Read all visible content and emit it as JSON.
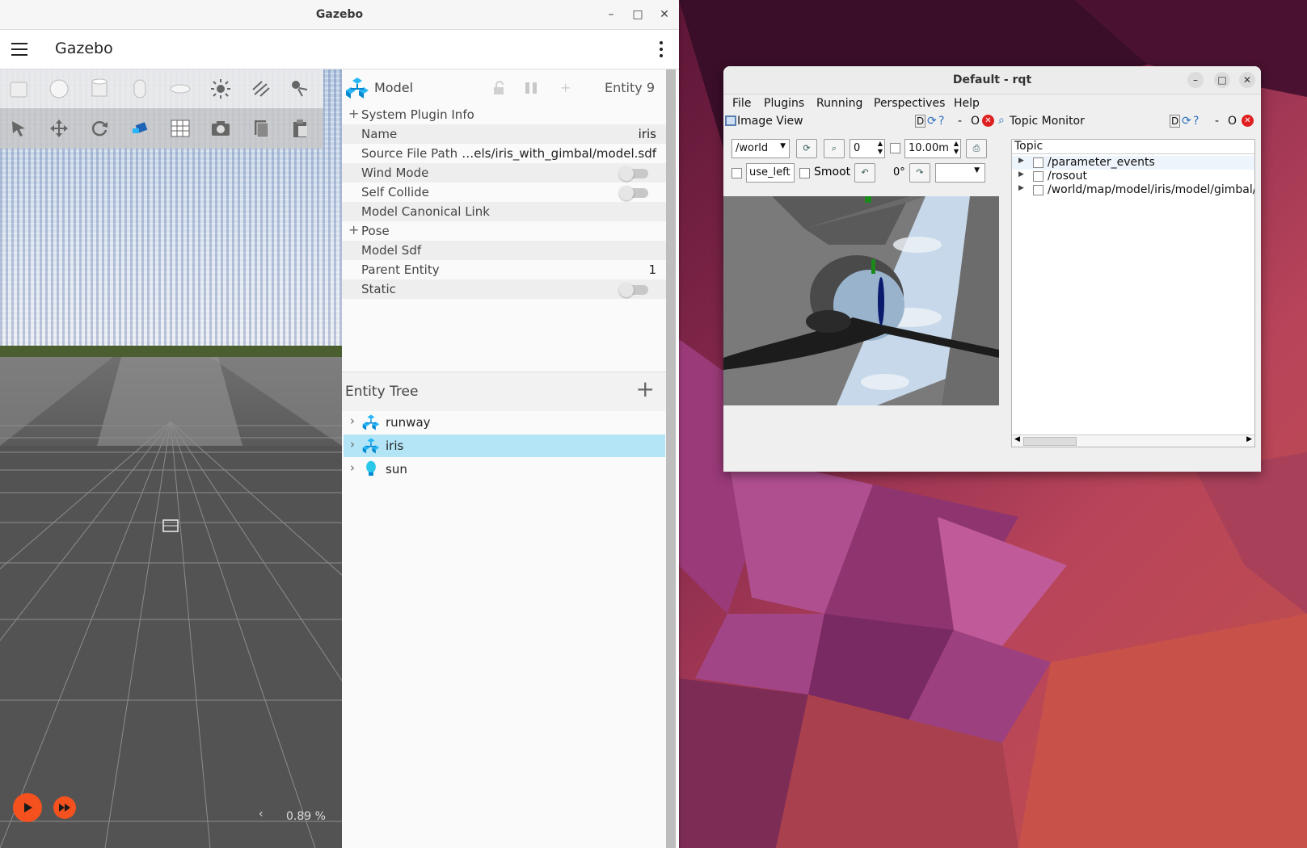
{
  "gazebo": {
    "window_title": "Gazebo",
    "app_title": "Gazebo",
    "window_controls": {
      "minimize": "–",
      "maximize": "□",
      "close": "✕"
    },
    "component_inspector": {
      "title": "Model",
      "entity_label": "Entity 9",
      "rows": [
        {
          "key": "System Plugin Info",
          "value": "",
          "expandable": true
        },
        {
          "key": "Name",
          "value": "iris"
        },
        {
          "key": "Source File Path",
          "value": "…els/iris_with_gimbal/model.sdf"
        },
        {
          "key": "Wind Mode",
          "value": "",
          "toggle": false
        },
        {
          "key": "Self Collide",
          "value": "",
          "toggle": false
        },
        {
          "key": "Model Canonical Link",
          "value": ""
        },
        {
          "key": "Pose",
          "value": "",
          "expandable": true
        },
        {
          "key": "Model Sdf",
          "value": ""
        },
        {
          "key": "Parent Entity",
          "value": "1"
        },
        {
          "key": "Static",
          "value": "",
          "toggle": false
        }
      ]
    },
    "entity_tree": {
      "title": "Entity Tree",
      "add_label": "+",
      "items": [
        {
          "name": "runway",
          "icon": "model-icon",
          "selected": false
        },
        {
          "name": "iris",
          "icon": "model-icon",
          "selected": true
        },
        {
          "name": "sun",
          "icon": "light-icon",
          "selected": false
        }
      ]
    },
    "scene": {
      "rtf": "0.89 %",
      "collapse_arrow": "‹"
    },
    "colors": {
      "accent": "#f4511e",
      "selection": "#b3e5f7",
      "model_icon": "#29b6f6"
    }
  },
  "rqt": {
    "window_title": "Default - rqt",
    "menu": [
      "File",
      "Plugins",
      "Running",
      "Perspectives",
      "Help"
    ],
    "image_view": {
      "title": "Image View",
      "dock_controls": "D",
      "topic_value": "/world",
      "spin_value": "0",
      "max_range": "10.00m",
      "use_left_label": "use_left",
      "smooth_label": "Smoot",
      "rotation": "0°"
    },
    "topic_monitor": {
      "title": "Topic Monitor",
      "dock_controls": "D",
      "column_header": "Topic",
      "topics": [
        "/parameter_events",
        "/rosout",
        "/world/map/model/iris/model/gimbal/"
      ]
    }
  }
}
